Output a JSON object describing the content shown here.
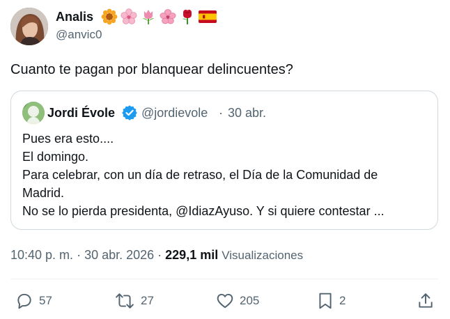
{
  "tweet": {
    "author": {
      "display_name": "Analis",
      "emojis": [
        "sunflower-emoji",
        "cherry-blossom-emoji",
        "tulip-emoji",
        "hibiscus-emoji",
        "rose-emoji",
        "spain-flag-emoji"
      ],
      "handle": "@anvic0"
    },
    "text": "Cuanto te pagan por blanquear delincuentes?",
    "quoted": {
      "display_name": "Jordi Évole",
      "handle": "@jordievole",
      "separator": "·",
      "date": "30 abr.",
      "lines": [
        "Pues era esto....",
        "El domingo.",
        "Para celebrar, con un día de retraso, el Día de la Comunidad de",
        "Madrid.",
        "No se lo pierda presidenta, @IdiazAyuso. Y si quiere contestar ..."
      ]
    },
    "meta": {
      "time": "10:40 p. m.",
      "sep1": " · ",
      "date": "30 abr. 2026",
      "sep2": " · ",
      "views_count": "229,1 mil",
      "views_label": "Visualizaciones"
    },
    "actions": {
      "replies": "57",
      "retweets": "27",
      "likes": "205",
      "bookmarks": "2"
    },
    "colors": {
      "text": "#0f1419",
      "secondary": "#536471",
      "border": "#cfd9de",
      "verified": "#1d9bf0"
    }
  }
}
